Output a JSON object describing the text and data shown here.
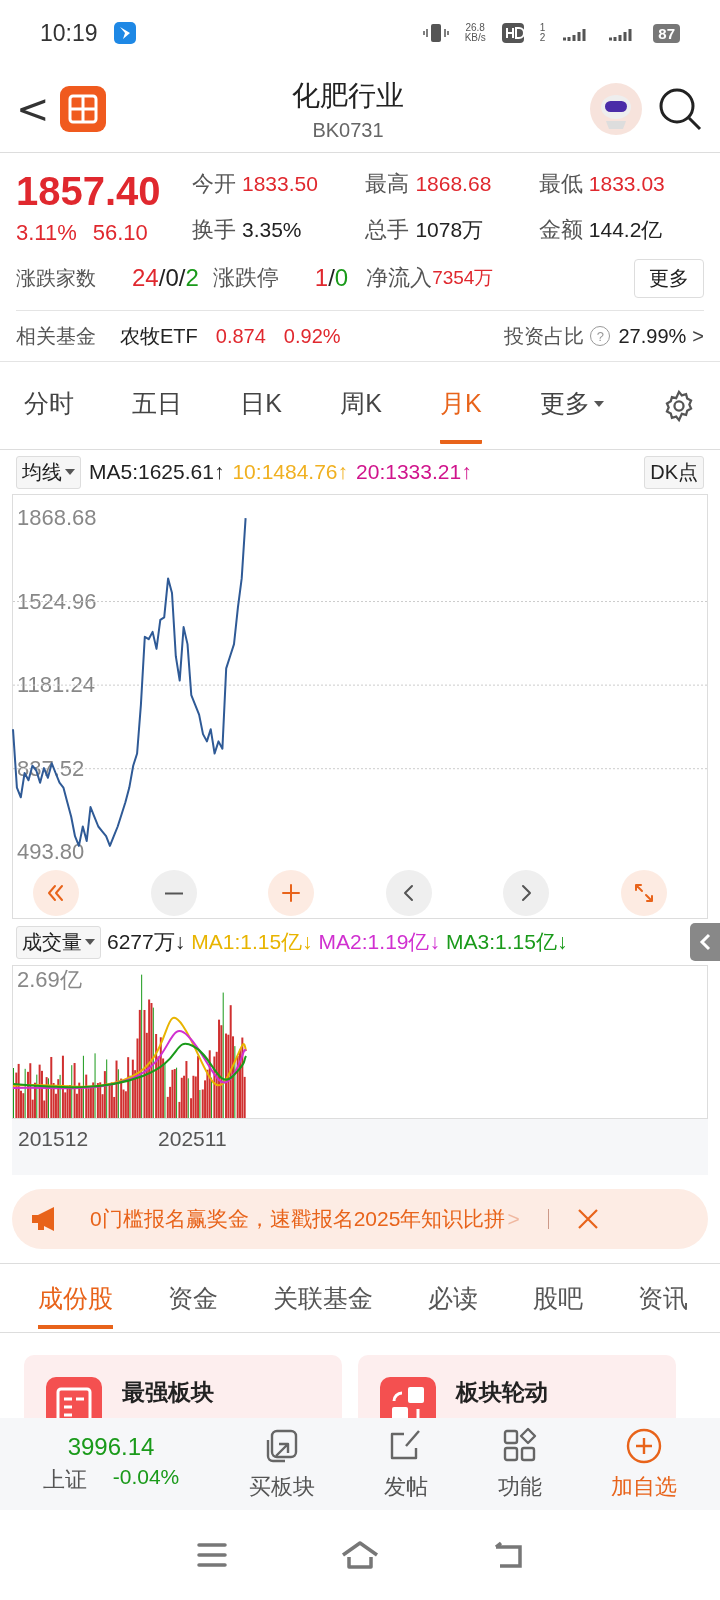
{
  "status_bar": {
    "time": "10:19",
    "net_speed": "26.8",
    "net_unit": "KB/s",
    "sim_a": "1",
    "sim_b": "2",
    "battery": "87"
  },
  "header": {
    "back": "<",
    "title": "化肥行业",
    "code": "BK0731"
  },
  "quote": {
    "price": "1857.40",
    "change_pct": "3.11%",
    "change": "56.10",
    "stats": [
      {
        "label": "今开",
        "value": "1833.50",
        "color": "#e0282e"
      },
      {
        "label": "最高",
        "value": "1868.68",
        "color": "#e0282e"
      },
      {
        "label": "最低",
        "value": "1833.03",
        "color": "#e0282e"
      },
      {
        "label": "换手",
        "value": "3.35%",
        "color": "#222222"
      },
      {
        "label": "总手",
        "value": "1078万",
        "color": "#222222"
      },
      {
        "label": "金额",
        "value": "144.2亿",
        "color": "#222222"
      }
    ]
  },
  "breadth": {
    "label": "涨跌家数",
    "up": "24",
    "sep_1": "/",
    "flat": "0",
    "sep_2": "/",
    "down": "2"
  },
  "limits": {
    "label": "涨跌停",
    "up": "1",
    "sep": "/",
    "down": "0"
  },
  "net_inflow": {
    "label": "净流入",
    "value": "7354万"
  },
  "more_button": "更多",
  "fund": {
    "label": "相关基金",
    "name": "农牧ETF",
    "price": "0.874",
    "change": "0.92%",
    "ratio_label": "投资占比",
    "help": "?",
    "ratio": "27.99%",
    "chevron": ">"
  },
  "periods": [
    {
      "label": "分时",
      "selected": false,
      "kind": "tab"
    },
    {
      "label": "五日",
      "selected": false,
      "kind": "tab"
    },
    {
      "label": "日K",
      "selected": false,
      "kind": "tab"
    },
    {
      "label": "周K",
      "selected": false,
      "kind": "tab"
    },
    {
      "label": "月K",
      "selected": true,
      "kind": "tab"
    },
    {
      "label": "更多",
      "selected": false,
      "kind": "menu"
    }
  ],
  "ma_row": {
    "selector": "均线",
    "items": [
      {
        "text": "MA5:1625.61↑",
        "color": "#222222"
      },
      {
        "text": "10:1484.76↑",
        "color": "#f0b020"
      },
      {
        "text": "20:1333.21↑",
        "color": "#d0148c"
      }
    ],
    "dk_button": "DK点"
  },
  "price_chart": {
    "chart_data": {
      "type": "line",
      "grid": true,
      "categories": [
        null,
        null,
        null,
        null,
        null,
        null,
        null,
        null,
        null,
        null,
        null,
        null,
        null,
        null,
        null,
        null,
        null,
        null,
        null,
        null,
        null,
        null,
        null,
        null,
        null,
        null,
        null,
        null,
        null,
        null,
        null,
        null,
        null,
        null,
        null,
        null,
        null,
        null,
        null,
        null,
        null,
        null,
        null,
        null,
        null,
        null,
        null,
        null,
        null,
        null,
        null,
        null,
        null,
        null,
        null,
        null,
        null,
        null,
        null,
        null,
        null,
        null,
        null,
        null,
        null,
        null,
        null,
        null,
        null,
        null,
        null,
        null,
        null,
        null,
        null,
        null,
        null,
        null,
        null,
        null,
        null,
        null,
        null,
        null,
        null,
        null,
        null,
        null,
        null,
        null,
        null,
        null,
        null,
        null,
        null,
        null,
        null,
        null,
        null,
        null,
        null,
        null,
        null,
        null,
        null,
        null,
        null,
        null,
        null,
        null,
        null,
        null,
        null,
        null,
        null,
        null,
        null,
        null,
        null,
        null,
        null,
        null,
        null,
        null,
        null,
        null,
        null,
        null,
        null,
        null,
        null,
        null,
        null,
        null,
        null,
        null,
        null,
        null,
        null,
        null,
        null,
        null,
        null,
        null,
        null,
        null,
        null,
        null,
        null,
        null,
        null,
        null,
        null,
        null,
        null,
        null,
        null,
        null,
        null,
        null,
        null,
        null,
        null,
        null,
        null,
        null,
        null,
        null,
        null,
        null,
        null,
        null,
        null,
        null,
        null,
        null,
        null,
        null,
        null,
        null
      ],
      "ylim": [
        223.7,
        1963
      ],
      "yticks": [
        1868.68,
        1524.96,
        1181.24,
        837.52,
        {
          "value": 493.8,
          "label": "493.80"
        }
      ],
      "series": [
        {
          "color": "#2f5a96",
          "values": [
            1000,
            760,
            720,
            820,
            790,
            850,
            830,
            780,
            840,
            800,
            860,
            820,
            780,
            760,
            700,
            640,
            560,
            520,
            600,
            540,
            680,
            640,
            600,
            580,
            560,
            520,
            560,
            600,
            650,
            700,
            760,
            850,
            900,
            1100,
            1380,
            1370,
            1400,
            1330,
            1450,
            1460,
            1620,
            1560,
            1300,
            1200,
            1420,
            1350,
            1140,
            1100,
            1060,
            980,
            950,
            1000,
            900,
            950,
            920,
            1250,
            1300,
            1350,
            1500,
            1620,
            1868,
            null,
            null,
            null,
            null,
            null,
            null,
            null,
            null,
            null,
            null,
            null,
            null,
            null,
            null,
            null,
            null,
            null,
            null,
            null,
            null,
            null,
            null,
            null,
            null,
            null,
            null,
            null,
            null,
            null,
            null,
            null,
            null,
            null,
            null,
            null,
            null,
            null,
            null,
            null,
            null,
            null,
            null,
            null,
            null,
            null,
            null,
            null,
            null,
            null,
            null,
            null,
            null,
            null,
            null,
            null,
            null,
            null,
            null,
            null,
            null,
            null,
            null,
            null,
            null,
            null,
            null,
            null,
            null,
            null,
            null,
            null,
            null,
            null,
            null,
            null,
            null,
            null,
            null,
            null,
            null,
            null,
            null,
            null,
            null,
            null,
            null,
            null,
            null,
            null,
            null,
            null,
            null,
            null,
            null,
            null,
            null,
            null,
            null,
            null,
            null,
            null,
            null,
            null,
            null,
            null,
            null,
            null,
            null,
            null,
            null,
            null,
            null,
            null,
            null,
            null,
            null,
            null,
            null,
            null
          ]
        }
      ]
    }
  },
  "chart_controls": [
    {
      "kind": "rewind"
    },
    {
      "kind": "zoom-out"
    },
    {
      "kind": "zoom-in"
    },
    {
      "kind": "prev"
    },
    {
      "kind": "next"
    },
    {
      "kind": "expand"
    }
  ],
  "volume": {
    "selector": "成交量",
    "items": [
      {
        "text": "6277万↓",
        "color": "#222222"
      },
      {
        "text": "MA1:1.15亿↓",
        "color": "#e8b400"
      },
      {
        "text": "MA2:1.19亿↓",
        "color": "#d030d0"
      },
      {
        "text": "MA3:1.15亿↓",
        "color": "#1a9a1a"
      }
    ],
    "y_label": "2.69亿",
    "x_labels": [
      "201512",
      "202511"
    ]
  },
  "banner": {
    "text": "0门槛报名赢奖金，速戳报名2025年知识比拼",
    "chevron": ">"
  },
  "section_tabs": [
    {
      "label": "成份股",
      "selected": true
    },
    {
      "label": "资金",
      "selected": false
    },
    {
      "label": "关联基金",
      "selected": false
    },
    {
      "label": "必读",
      "selected": false
    },
    {
      "label": "股吧",
      "selected": false
    },
    {
      "label": "资讯",
      "selected": false
    }
  ],
  "cards": [
    {
      "title": "最强板块",
      "kind": "list"
    },
    {
      "title": "板块轮动",
      "kind": "rotate"
    }
  ],
  "index_ticker": {
    "value": "3996.14",
    "name": "上证",
    "change": "-0.04%"
  },
  "actions": [
    {
      "label": "买板块",
      "kind": "buy"
    },
    {
      "label": "发帖",
      "kind": "post"
    },
    {
      "label": "功能",
      "kind": "apps"
    },
    {
      "label": "加自选",
      "kind": "add"
    }
  ]
}
